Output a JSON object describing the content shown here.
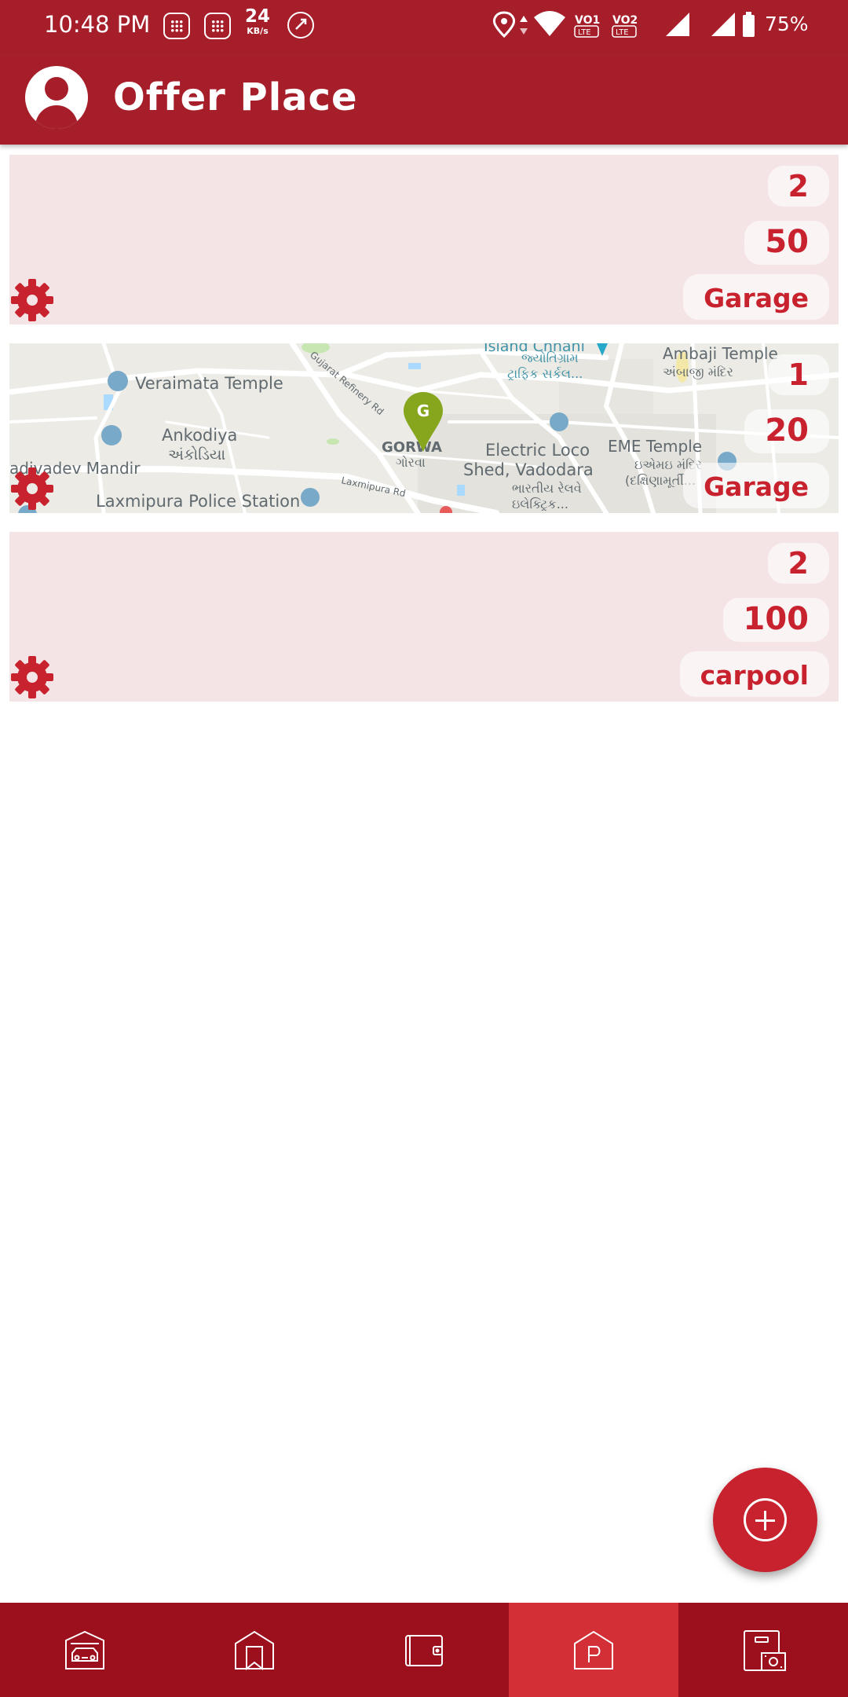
{
  "status_bar": {
    "time": "10:48 PM",
    "net_speed_value": "24",
    "net_speed_unit": "KB/s",
    "sim1_label": "VO1",
    "sim2_label": "VO2",
    "lte_label": "LTE",
    "battery": "75%",
    "icons": [
      "message-icon",
      "message-icon",
      "call-icon",
      "location-icon",
      "data-arrows-icon",
      "wifi-icon",
      "signal-icon",
      "battery-icon"
    ]
  },
  "app_bar": {
    "title": "Offer Place",
    "icon": "account-circle-icon"
  },
  "offers": [
    {
      "count": "2",
      "price": "50",
      "type": "Garage",
      "has_map": false
    },
    {
      "count": "1",
      "price": "20",
      "type": "Garage",
      "has_map": true
    },
    {
      "count": "2",
      "price": "100",
      "type": "carpool",
      "has_map": false
    }
  ],
  "map_labels": {
    "veraimata": "Veraimata Temple",
    "ankodiya": "Ankodiya",
    "ankodiya_guj": "અંકોડિયા",
    "mandir": "adivadev Mandir",
    "laxmipura_station": "Laxmipura Police Station",
    "laxmipura_rd": "Laxmipura Rd",
    "refinery_rd": "Gujarat Refinery Rd",
    "gorwa": "GORWA",
    "gorwa_guj": "ગોરવા",
    "pin_letter": "G",
    "island": "Island Chhani",
    "island_guj1": "જ્યોતિગ્રામ",
    "island_guj2": "ટ્રાફિક સર્કલ...",
    "loco1": "Electric Loco",
    "loco2": "Shed, Vadodara",
    "loco_guj1": "ભારતીય રેલવે",
    "loco_guj2": "ઇલેક્ટ્રિક...",
    "ambaji": "Ambaji Temple",
    "ambaji_guj": "અંબાજી મંદિર",
    "eme": "EME Temple",
    "eme_guj1": "ઇએમઇ મંદિર",
    "eme_guj2": "(દક્ષિણામૂર્તી..."
  },
  "fab": {
    "icon": "add-circle-icon"
  },
  "bottom_nav": {
    "items": [
      {
        "icon": "car-garage-icon",
        "active": false
      },
      {
        "icon": "bookmark-house-icon",
        "active": false
      },
      {
        "icon": "wallet-icon",
        "active": false
      },
      {
        "icon": "parking-icon",
        "active": true
      },
      {
        "icon": "cash-register-icon",
        "active": false
      }
    ]
  },
  "colors": {
    "primary": "#a61e2a",
    "accent": "#c8222e",
    "card_bg": "#f4e4e6",
    "nav_bg": "#9c0f1c",
    "nav_active": "#d22f36"
  }
}
